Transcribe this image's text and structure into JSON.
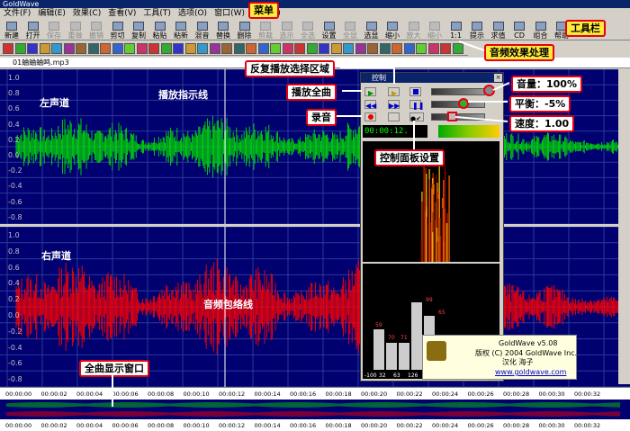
{
  "app_title": "GoldWave",
  "menu": [
    "文件(F)",
    "编辑(E)",
    "效果(C)",
    "查看(V)",
    "工具(T)",
    "选项(O)",
    "窗口(W)",
    "帮助(H)"
  ],
  "toolbar": [
    "新建",
    "打开",
    "保存",
    "重做",
    "撤销",
    "剪切",
    "复制",
    "粘贴",
    "粘新",
    "混音",
    "替换",
    "删除",
    "剪裁",
    "选示",
    "全选",
    "设置",
    "全显",
    "选显",
    "缩小",
    "放大",
    "缩小",
    "1:1",
    "提示",
    "求值",
    "CD",
    "组合",
    "帮助"
  ],
  "toolbar_disabled": [
    2,
    3,
    4,
    12,
    13,
    14,
    16,
    19,
    20
  ],
  "document_title": "01蛐蛐蛐鸣.mp3",
  "y_axis_top": [
    "1.0",
    "0.8",
    "0.6",
    "0.4",
    "0.2",
    "0.0",
    "-0.2",
    "-0.4",
    "-0.6",
    "-0.8"
  ],
  "y_axis_bottom": [
    "1.0",
    "0.8",
    "0.6",
    "0.4",
    "0.2",
    "0.0",
    "-0.2",
    "-0.4",
    "-0.6",
    "-0.8"
  ],
  "timeline": [
    "00:00:00",
    "00:00:02",
    "00:00:04",
    "00:00:06",
    "00:00:08",
    "00:00:10",
    "00:00:12",
    "00:00:14",
    "00:00:16",
    "00:00:18",
    "00:00:20",
    "00:00:22",
    "00:00:24",
    "00:00:26",
    "00:00:28",
    "00:00:30",
    "00:00:32"
  ],
  "control_panel": {
    "title": "控制",
    "time": "00:00:12.",
    "bar_values": [
      "59",
      "70",
      "71",
      "99",
      "65"
    ],
    "bar_labels": [
      "-100",
      "32",
      "63",
      "126",
      "253"
    ]
  },
  "about": {
    "line1": "GoldWave v5.08",
    "line2": "版权 (C) 2004 GoldWave Inc.",
    "line3": "汉化 海子",
    "line4": "www.goldwave.com"
  },
  "annotations": {
    "menu": "菜单",
    "toolbar": "工具栏",
    "effects": "音频效果处理",
    "repeat": "反复播放选择区域",
    "play_all": "播放全曲",
    "record": "录音",
    "ctrl_settings": "控制面板设置",
    "volume": "音量：100%",
    "balance": "平衡：-5%",
    "speed": "速度：1.00",
    "left_channel": "左声道",
    "right_channel": "右声道",
    "play_line": "播放指示线",
    "envelope": "音频包络线",
    "overview": "全曲显示窗口"
  },
  "colors": {
    "left_wave": "#00e000",
    "right_wave": "#ff0000",
    "wave_bg": "#000070",
    "callout_border": "#e60012"
  }
}
